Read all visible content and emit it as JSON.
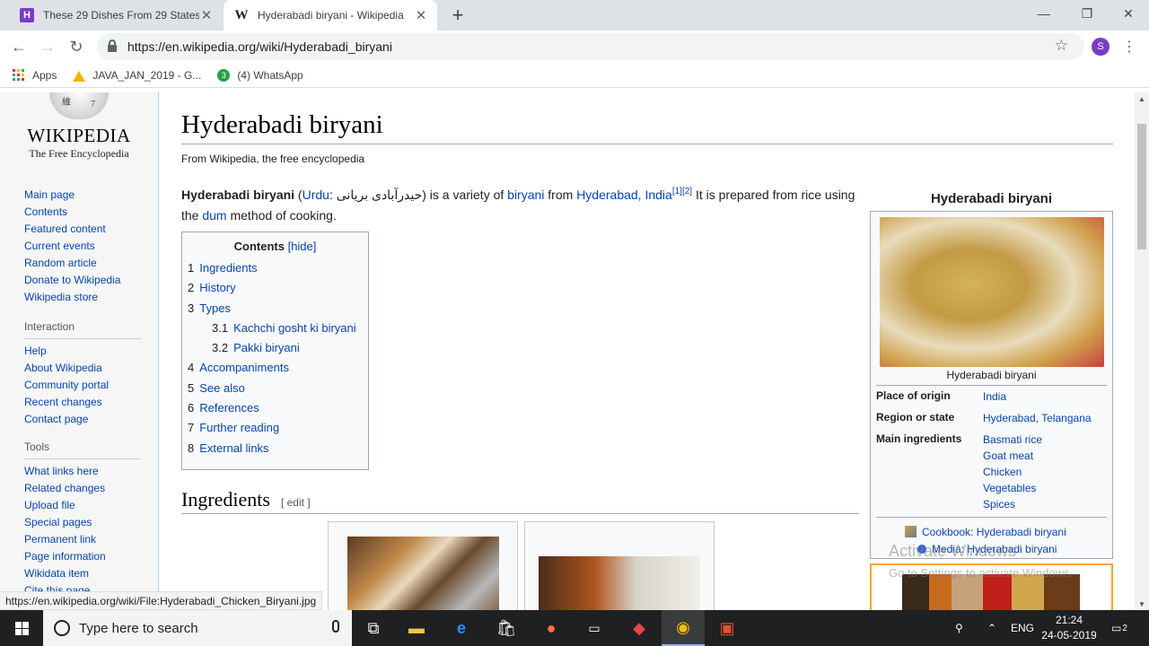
{
  "browser": {
    "tabs": [
      {
        "title": "These 29 Dishes From 29 States I",
        "favicon": "H"
      },
      {
        "title": "Hyderabadi biryani - Wikipedia",
        "favicon": "W"
      }
    ],
    "new_tab": "+",
    "window_controls": {
      "minimize": "—",
      "restore": "❐",
      "close": "✕"
    },
    "url": "https://en.wikipedia.org/wiki/Hyderabadi_biryani",
    "profile_initial": "S",
    "bookmarks": [
      {
        "label": "Apps",
        "icon": "apps-grid-icon"
      },
      {
        "label": "JAVA_JAN_2019 - G...",
        "icon": "google-drive-icon"
      },
      {
        "label": "(4) WhatsApp",
        "icon": "whatsapp-icon"
      }
    ],
    "status_url": "https://en.wikipedia.org/wiki/File:Hyderabadi_Chicken_Biryani.jpg"
  },
  "wiki": {
    "wordmark": "WIKIPEDIA",
    "tagline": "The Free Encyclopedia",
    "nav_main": [
      "Main page",
      "Contents",
      "Featured content",
      "Current events",
      "Random article",
      "Donate to Wikipedia",
      "Wikipedia store"
    ],
    "interaction_title": "Interaction",
    "nav_interaction": [
      "Help",
      "About Wikipedia",
      "Community portal",
      "Recent changes",
      "Contact page"
    ],
    "tools_title": "Tools",
    "nav_tools": [
      "What links here",
      "Related changes",
      "Upload file",
      "Special pages",
      "Permanent link",
      "Page information",
      "Wikidata item",
      "Cite this page"
    ]
  },
  "article": {
    "title": "Hyderabadi biryani",
    "from": "From Wikipedia, the free encyclopedia",
    "lead": {
      "bold": "Hyderabadi biryani",
      "paren_open": " (",
      "urdu_link": "Urdu",
      "urdu_text": ": حیدرآبادی بریانی",
      "t1": ") is a variety of ",
      "link1": "biryani",
      "t2": " from ",
      "link2": "Hyderabad, India",
      "ref": "[1][2]",
      "t3": " It is prepared from rice using the ",
      "link3": "dum",
      "t4": " method of cooking."
    },
    "toc": {
      "title": "Contents",
      "hide": "[hide]",
      "items": [
        {
          "num": "1",
          "label": "Ingredients"
        },
        {
          "num": "2",
          "label": "History"
        },
        {
          "num": "3",
          "label": "Types"
        },
        {
          "num": "3.1",
          "label": "Kachchi gosht ki biryani"
        },
        {
          "num": "3.2",
          "label": "Pakki biryani"
        },
        {
          "num": "4",
          "label": "Accompaniments"
        },
        {
          "num": "5",
          "label": "See also"
        },
        {
          "num": "6",
          "label": "References"
        },
        {
          "num": "7",
          "label": "Further reading"
        },
        {
          "num": "8",
          "label": "External links"
        }
      ]
    },
    "section_heading": "Ingredients",
    "edit_label": "[ edit ]"
  },
  "infobox": {
    "title": "Hyderabadi biryani",
    "caption": "Hyderabadi biryani",
    "place_label": "Place of origin",
    "place_value": "India",
    "region_label": "Region or state",
    "region_value": "Hyderabad, Telangana",
    "ingredients_label": "Main ingredients",
    "ingredients": [
      "Basmati rice",
      "Goat meat",
      "Chicken",
      "Vegetables",
      "Spices"
    ],
    "cookbook": "Cookbook: Hyderabadi biryani",
    "media": "Media: Hyderabadi biryani"
  },
  "watermark": {
    "line1": "Activate Windows",
    "line2": "Go to Settings to activate Windows."
  },
  "taskbar": {
    "search_placeholder": "Type here to search",
    "lang": "ENG",
    "time": "21:24",
    "date": "24-05-2019",
    "notifications": "2"
  }
}
